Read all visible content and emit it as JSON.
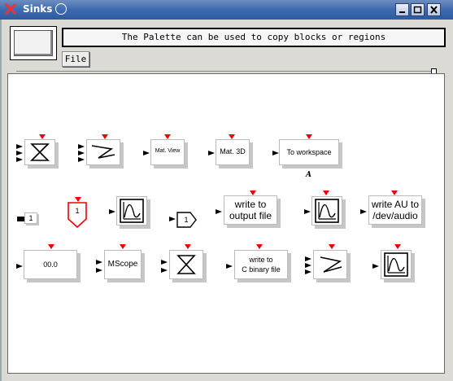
{
  "window": {
    "title": "Sinks",
    "minimize_symbol": "▁",
    "maximize_symbol": "□",
    "close_symbol": "✕"
  },
  "palette": {
    "message": "The Palette can be used to copy blocks or regions",
    "menu_file": "File"
  },
  "blocks": {
    "mat_view": "Mat. View",
    "mat_3d": "Mat. 3D",
    "to_workspace": "To workspace",
    "to_workspace_var": "A",
    "constant_out": "1",
    "event_out": "1",
    "goto_tag": "1",
    "write_output_line1": "write to",
    "write_output_line2": "output file",
    "write_au_line1": "write AU to",
    "write_au_line2": "/dev/audio",
    "display_value": "00.0",
    "mscope": "MScope",
    "write_c_line1": "write to",
    "write_c_line2": "C binary file"
  },
  "colors": {
    "titlebar": "#3d6ab0",
    "event_port": "#e00000",
    "canvas": "#ffffff"
  }
}
